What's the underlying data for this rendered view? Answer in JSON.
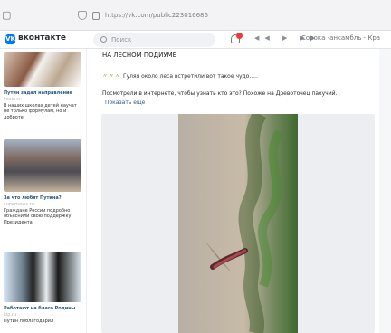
{
  "browser": {
    "tabs_icon": "tab-square",
    "url": "https://vk.com/public223016686"
  },
  "header": {
    "brand": "вконтакте",
    "logo": "VK",
    "search_placeholder": "Поиск",
    "now_playing": "Сорока -ансамбль - Кра"
  },
  "sidebar": {
    "cards": [
      {
        "title": "Путин задал направление",
        "source": "kasio.ru",
        "text": "В наших школах детей научат не только формулам, но и доброте"
      },
      {
        "title": "За что любят Путина?",
        "source": "supernews.ru",
        "text": "Граждане России подробно объяснили свою поддержку Президента"
      },
      {
        "title": "Работают на благо Родины",
        "source": "kip.ru",
        "text": "Путин поблагодарил"
      }
    ]
  },
  "post": {
    "title": "НА ЛЕСНОМ ПОДИУМЕ",
    "line": "Гуляя около леса встретили вот такое чудо.....",
    "question": "Посмотрели в интернете, чтобы узнать кто это? Похоже на Древоточец пахучий.",
    "more": "Показать ещё"
  },
  "colors": {
    "accent": "#2a5885",
    "vk_blue": "#0077ff",
    "notification": "#ef3a3a"
  }
}
